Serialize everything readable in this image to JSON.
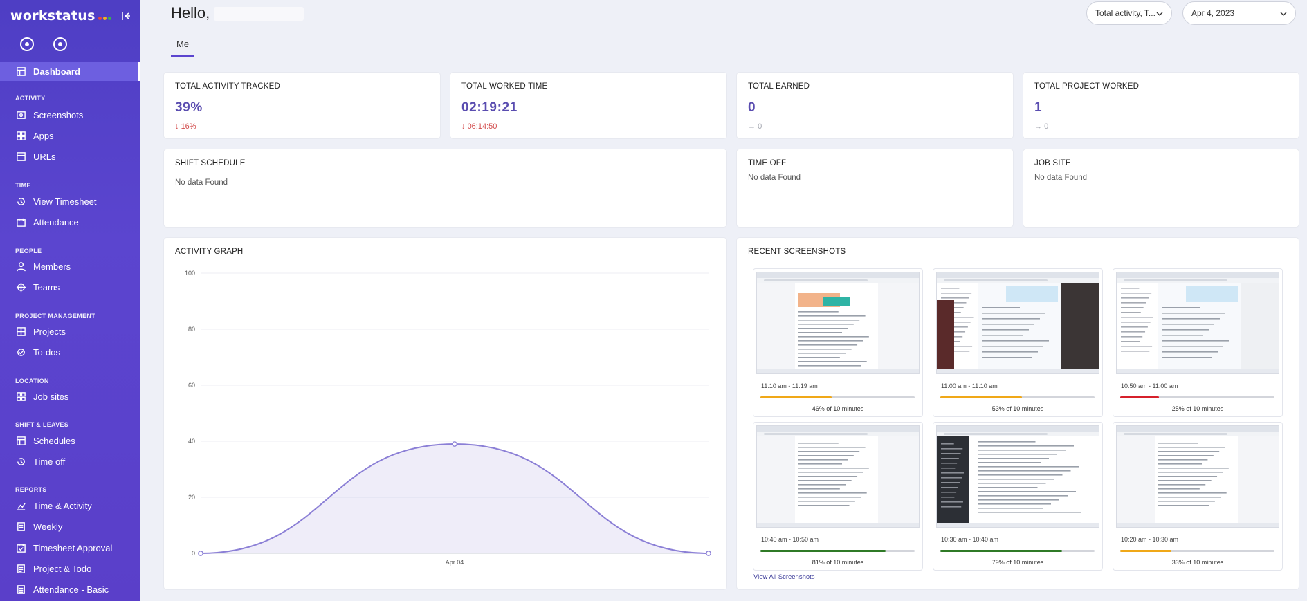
{
  "app": {
    "brand": "workstatus"
  },
  "sidebar": {
    "items": [
      {
        "label": "Dashboard",
        "icon": "dashboard-icon",
        "active": true
      },
      {
        "label": "Screenshots",
        "icon": "screenshots-icon"
      },
      {
        "label": "Apps",
        "icon": "apps-icon"
      },
      {
        "label": "URLs",
        "icon": "urls-icon"
      },
      {
        "label": "View Timesheet",
        "icon": "timesheet-icon"
      },
      {
        "label": "Attendance",
        "icon": "attendance-icon"
      },
      {
        "label": "Members",
        "icon": "members-icon"
      },
      {
        "label": "Teams",
        "icon": "teams-icon"
      },
      {
        "label": "Projects",
        "icon": "projects-icon"
      },
      {
        "label": "To-dos",
        "icon": "todos-icon"
      },
      {
        "label": "Job sites",
        "icon": "job-sites-icon"
      },
      {
        "label": "Schedules",
        "icon": "schedules-icon"
      },
      {
        "label": "Time off",
        "icon": "time-off-icon"
      },
      {
        "label": "Time & Activity",
        "icon": "time-activity-icon"
      },
      {
        "label": "Weekly",
        "icon": "weekly-icon"
      },
      {
        "label": "Timesheet Approval",
        "icon": "timesheet-approval-icon"
      },
      {
        "label": "Project & Todo",
        "icon": "project-todo-icon"
      },
      {
        "label": "Attendance - Basic",
        "icon": "attendance-basic-icon"
      }
    ],
    "sections": [
      "ACTIVITY",
      "TIME",
      "PEOPLE",
      "PROJECT MANAGEMENT",
      "LOCATION",
      "SHIFT & LEAVES",
      "REPORTS"
    ]
  },
  "header": {
    "greeting": "Hello,",
    "filter_select": "Total activity, T...",
    "date_select": "Apr 4, 2023",
    "tab": "Me"
  },
  "stats": [
    {
      "title": "TOTAL ACTIVITY TRACKED",
      "value": "39%",
      "delta": "16%",
      "trend": "down"
    },
    {
      "title": "TOTAL WORKED TIME",
      "value": "02:19:21",
      "delta": "06:14:50",
      "trend": "down"
    },
    {
      "title": "TOTAL EARNED",
      "value": "0",
      "delta": "0",
      "trend": "flat"
    },
    {
      "title": "TOTAL PROJECT WORKED",
      "value": "1",
      "delta": "0",
      "trend": "flat"
    }
  ],
  "panels": {
    "shift_schedule": {
      "title": "SHIFT SCHEDULE",
      "empty": "No data Found"
    },
    "time_off": {
      "title": "TIME OFF",
      "empty": "No data Found"
    },
    "job_site": {
      "title": "JOB SITE",
      "empty": "No data Found"
    }
  },
  "activity_graph": {
    "title": "ACTIVITY GRAPH"
  },
  "chart_data": {
    "type": "area",
    "x": [
      "",
      "Apr 04",
      ""
    ],
    "series": [
      {
        "values": [
          0,
          39,
          0
        ]
      }
    ],
    "yticks": [
      0,
      20,
      40,
      60,
      80,
      100
    ],
    "ylim": [
      0,
      100
    ],
    "grid": true,
    "color": "#8b7fd6"
  },
  "recent_screenshots": {
    "title": "RECENT SCREENSHOTS",
    "view_all": "View All Screenshots",
    "items": [
      {
        "time": "11:10 am - 11:19 am",
        "pct_label": "46% of 10 minutes",
        "pct": 46,
        "color": "#f0a818",
        "theme": "light"
      },
      {
        "time": "11:00 am - 11:10 am",
        "pct_label": "53% of 10 minutes",
        "pct": 53,
        "color": "#f0a818",
        "theme": "chat"
      },
      {
        "time": "10:50 am - 11:00 am",
        "pct_label": "25% of 10 minutes",
        "pct": 25,
        "color": "#d6202b",
        "theme": "chat"
      },
      {
        "time": "10:40 am - 10:50 am",
        "pct_label": "81% of 10 minutes",
        "pct": 81,
        "color": "#2f7a26",
        "theme": "light"
      },
      {
        "time": "10:30 am - 10:40 am",
        "pct_label": "79% of 10 minutes",
        "pct": 79,
        "color": "#2f7a26",
        "theme": "dark"
      },
      {
        "time": "10:20 am - 10:30 am",
        "pct_label": "33% of 10 minutes",
        "pct": 33,
        "color": "#f0a818",
        "theme": "light"
      }
    ]
  }
}
